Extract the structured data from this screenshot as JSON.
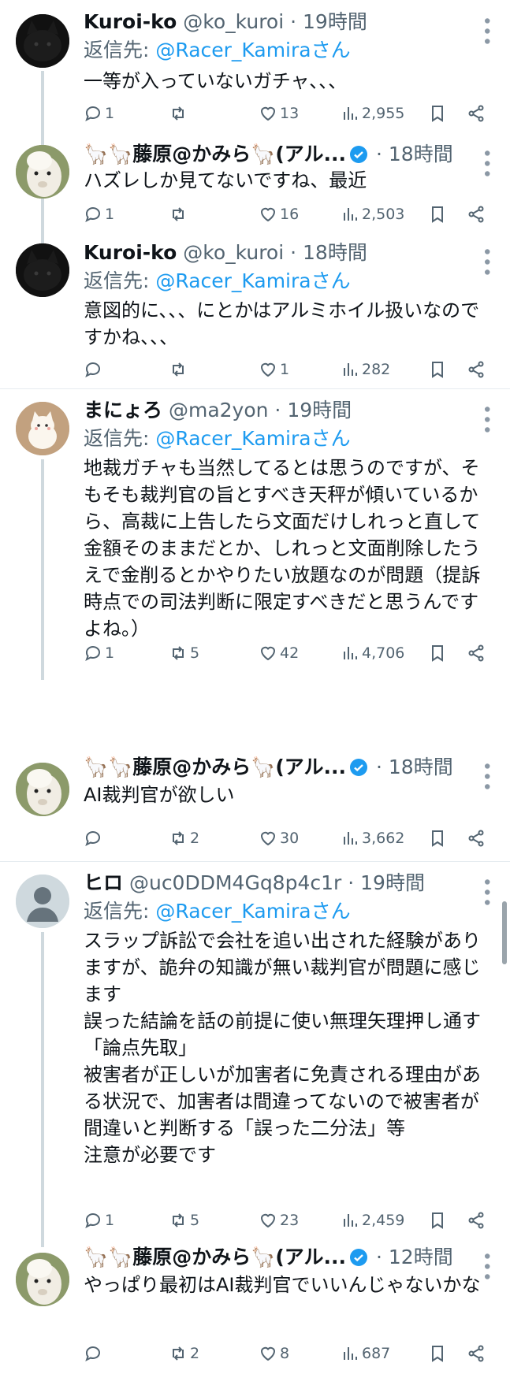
{
  "tweets": [
    {
      "name": "Kuroi-ko",
      "handle": "@ko_kuroi",
      "time": "19時間",
      "reply_label": "返信先: ",
      "reply_to": "@Racer_Kamiraさん",
      "text": "一等が入っていないガチャ、、、",
      "stats": {
        "replies": "1",
        "retweets": "",
        "likes": "13",
        "views": "2,955"
      },
      "avatar": "dark-cat-avatar"
    },
    {
      "name": "🦙🦙藤原@かみら🦙(アル...",
      "handle": "",
      "time": "18時間",
      "verified": true,
      "text": "ハズレしか見てないですね、最近",
      "stats": {
        "replies": "1",
        "retweets": "",
        "likes": "16",
        "views": "2,503"
      },
      "avatar": "alpaca-avatar"
    },
    {
      "name": "Kuroi-ko",
      "handle": "@ko_kuroi",
      "time": "18時間",
      "reply_label": "返信先: ",
      "reply_to": "@Racer_Kamiraさん",
      "text": "意図的に、、、にとかはアルミホイル扱いなのですかね、、、",
      "stats": {
        "replies": "",
        "retweets": "",
        "likes": "1",
        "views": "282"
      },
      "avatar": "dark-cat-avatar"
    },
    {
      "name": "まにょろ",
      "handle": "@ma2yon",
      "time": "19時間",
      "reply_label": "返信先: ",
      "reply_to": "@Racer_Kamiraさん",
      "text": "地裁ガチャも当然してるとは思うのですが、そもそも裁判官の旨とすべき天秤が傾いているから、高裁に上告したら文面だけしれっと直して金額そのままだとか、しれっと文面削除したうえで金削るとかやりたい放題なのが問題（提訴時点での司法判断に限定すべきだと思うんですよね。）",
      "stats": {
        "replies": "1",
        "retweets": "5",
        "likes": "42",
        "views": "4,706"
      },
      "avatar": "cat-illustration-avatar"
    },
    {
      "name": "🦙🦙藤原@かみら🦙(アル...",
      "handle": "",
      "time": "18時間",
      "verified": true,
      "text": "AI裁判官が欲しい",
      "stats": {
        "replies": "",
        "retweets": "2",
        "likes": "30",
        "views": "3,662"
      },
      "avatar": "alpaca-avatar"
    },
    {
      "name": "ヒロ",
      "handle": "@uc0DDM4Gq8p4c1r",
      "time": "19時間",
      "reply_label": "返信先: ",
      "reply_to": "@Racer_Kamiraさん",
      "text": "スラップ訴訟で会社を追い出された経験がありますが、詭弁の知識が無い裁判官が問題に感じます\n誤った結論を話の前提に使い無理矢理押し通す「論点先取」\n被害者が正しいが加害者に免責される理由がある状況で、加害者は間違ってないので被害者が間違いと判断する「誤った二分法」等\n注意が必要です",
      "stats": {
        "replies": "1",
        "retweets": "5",
        "likes": "23",
        "views": "2,459"
      },
      "avatar": "default-profile-avatar"
    },
    {
      "name": "🦙🦙藤原@かみら🦙(アル...",
      "handle": "",
      "time": "12時間",
      "verified": true,
      "text": "やっぱり最初はAI裁判官でいいんじゃないかな",
      "stats": {
        "replies": "",
        "retweets": "2",
        "likes": "8",
        "views": "687"
      },
      "avatar": "alpaca-avatar"
    }
  ],
  "dot_separator": " · ",
  "colors": {
    "accent": "#1d9bf0",
    "secondary": "#536471",
    "text": "#0f1419",
    "thread_line": "#cfd9de",
    "divider": "#e6ecf0"
  }
}
